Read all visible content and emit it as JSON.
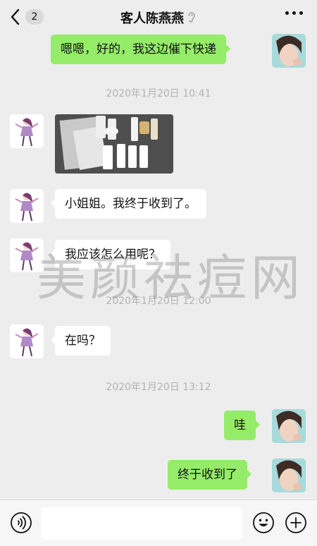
{
  "header": {
    "back_count": "2",
    "title": "客人陈燕燕"
  },
  "messages": {
    "m1": "嗯嗯，好的，我这边催下快递",
    "ts1": "2020年1月20日 10:41",
    "m2": "小姐姐。我终于收到了。",
    "m3": "我应该怎么用呢？",
    "ts2": "2020年1月20日 12:00",
    "m4": "在吗？",
    "ts3": "2020年1月20日 13:12",
    "m5": "哇",
    "m6": "终于收到了"
  },
  "watermark": "美颜祛痘网",
  "input": {
    "placeholder": ""
  },
  "colors": {
    "background": "#ededed",
    "outgoing_bubble": "#95ec69",
    "incoming_bubble": "#ffffff",
    "timestamp": "#b2b2b2"
  },
  "icons": [
    "chevron-left-icon",
    "ear-icon",
    "more-icon",
    "voice-icon",
    "emoji-icon",
    "plus-icon"
  ]
}
